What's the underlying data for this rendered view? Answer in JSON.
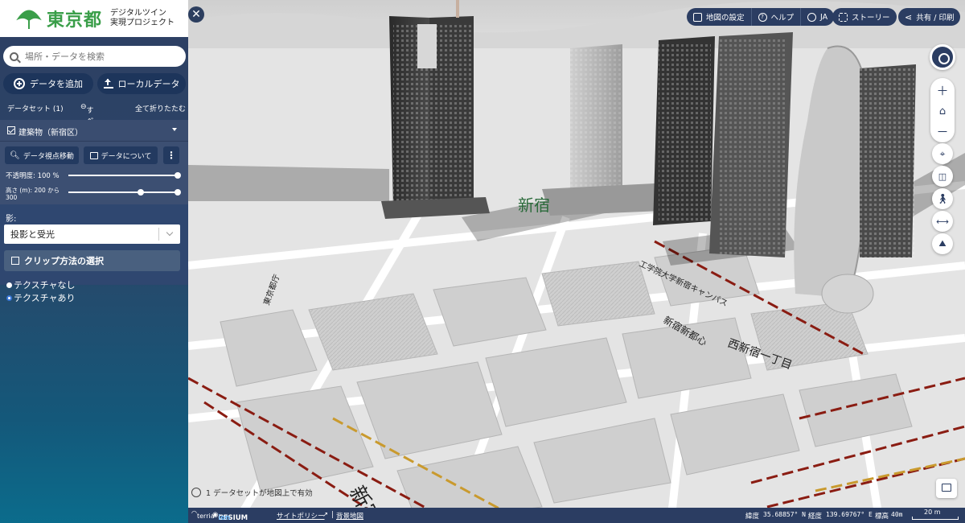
{
  "brand": {
    "logo_text": "東京都",
    "subtitle_line1": "デジタルツイン",
    "subtitle_line2": "実現プロジェクト"
  },
  "search": {
    "placeholder": "場所・データを検索"
  },
  "buttons": {
    "add_data": "データを追加",
    "local_data": "ローカルデータ"
  },
  "datasets": {
    "count_label": "データセット (1)",
    "remove_all": "すべて削除",
    "collapse_all": "全て折りたたむ"
  },
  "workbench_item": {
    "title": "建築物（新宿区）",
    "zoom_to": "データ視点移動",
    "about": "データについて",
    "opacity_label": "不透明度: 100 %",
    "opacity_value": 1.0,
    "height_label_line1": "高さ (m): 200 から",
    "height_label_line2": "300",
    "shadow_label": "影:",
    "shadow_option": "投影と受光",
    "clip_label": "クリップ方法の選択",
    "texture_none": "テクスチャなし",
    "texture_on": "テクスチャあり",
    "texture_selected": "テクスチャあり"
  },
  "toolbar": {
    "map_settings": "地図の設定",
    "help": "ヘルプ",
    "language": "JA",
    "story": "ストーリー",
    "share": "共有 / 印刷"
  },
  "map_labels": {
    "l1": "新宿駅",
    "l2": "西新宿一丁目",
    "l3": "新宿新都心",
    "l4": "工学院大学新宿キャンパス",
    "l5": "新宿",
    "l6": "東京都庁"
  },
  "status": {
    "notice": "1 データセットが地図上で有効",
    "terria": "terria",
    "cesium": "CESIUM",
    "ion": "ion",
    "site_policy": "サイトポリシー",
    "basemap": "背景地図",
    "lat_label": "緯度",
    "lat_value": "35.68857° N",
    "lon_label": "経度",
    "lon_value": "139.69767° E",
    "elev_label": "標高",
    "elev_value": "40m",
    "scale": "20 m"
  },
  "colors": {
    "accent": "#2b3d62",
    "brand_green": "#3a9e49",
    "rail_red": "#8a1c12",
    "rail_gold": "#c99a2e"
  }
}
